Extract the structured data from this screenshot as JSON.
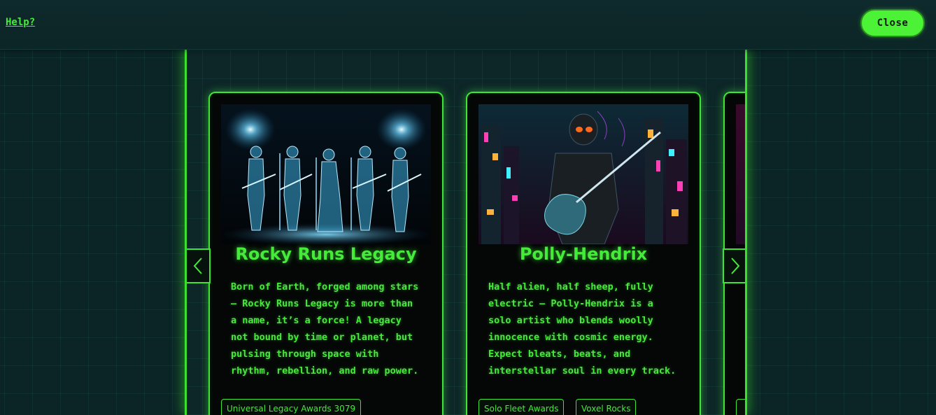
{
  "header": {
    "help_label": "Help?",
    "close_label": "Close"
  },
  "theme": {
    "accent": "#46ea3a",
    "background": "#0b2426",
    "card_background": "#040706"
  },
  "carousel": {
    "prev_icon": "chevron-left-icon",
    "next_icon": "chevron-right-icon",
    "cards": [
      {
        "title": "Rocky Runs Legacy",
        "image": "holographic-band-image",
        "description": "Born of Earth, forged among stars — Rocky Runs Legacy is more than a name, it’s a force! A legacy not bound by time or planet, but pulsing through space with rhythm, rebellion, and raw power.",
        "tags": [
          "Universal Legacy Awards 3079"
        ]
      },
      {
        "title": "Polly-Hendrix",
        "image": "cyber-guitarist-image",
        "description": "Half alien, half sheep, fully electric — Polly-Hendrix is a solo artist who blends woolly innocence with cosmic energy. Expect bleats, beats, and interstellar soul in every track.",
        "tags": [
          "Solo Fleet Awards",
          "Voxel Rocks"
        ]
      }
    ]
  }
}
